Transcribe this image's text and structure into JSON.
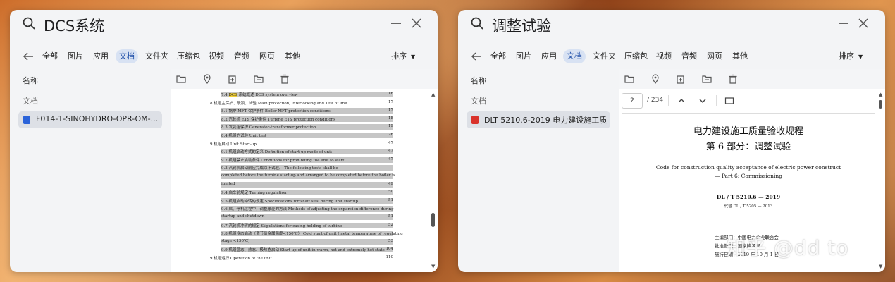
{
  "left_window": {
    "search_text": "DCS系统",
    "filters": [
      "全部",
      "图片",
      "应用",
      "文档",
      "文件夹",
      "压缩包",
      "视频",
      "音频",
      "网页",
      "其他"
    ],
    "active_filter": "文档",
    "sort_label": "排序",
    "column_header": "名称",
    "section_label": "文档",
    "file": {
      "name": "F014-1-SINOHYDRO-OPR-OM-...",
      "type_icon": "word-doc-icon",
      "icon_color": "#2b63d9"
    },
    "toc": [
      {
        "text": "7.4 DCS 系统概述  DCS system overview",
        "page": "16",
        "level": "sub"
      },
      {
        "text": "8 机组主保护、联锁、试验  Main protection, Interlocking and Test of unit",
        "page": "17",
        "level": "main"
      },
      {
        "text": "8.1 锅炉 MFT 保护条件  Boiler MFT protection conditions",
        "page": "17",
        "level": "sub"
      },
      {
        "text": "8.2 汽轮机 ETS 保护条件  Turbine ETS protection conditions",
        "page": "18",
        "level": "sub"
      },
      {
        "text": "8.3 发变组保护  Generator-transformer protection",
        "page": "19",
        "level": "sub"
      },
      {
        "text": "8.4 机组的试验  Unit test",
        "page": "26",
        "level": "sub"
      },
      {
        "text": "9 机组启动  Unit Start-up",
        "page": "47",
        "level": "main"
      },
      {
        "text": "9.1 机组启动方式的定义  Definition of start-up mode of unit",
        "page": "47",
        "level": "sub"
      },
      {
        "text": "9.2 机组禁止启动条件  Conditions for prohibiting the unit to start",
        "page": "47",
        "level": "sub"
      },
      {
        "text": "9.3 汽轮机启动前应完成以下试验。 The following tests shall be",
        "page": "",
        "level": "sub"
      },
      {
        "text": "completed before the turbine start-up and arranged to be completed before the boiler is",
        "page": "",
        "level": "sub"
      },
      {
        "text": "ignited",
        "page": "49",
        "level": "sub"
      },
      {
        "text": "9.4 启车前规定  Turning regulation",
        "page": "50",
        "level": "sub"
      },
      {
        "text": "9.5 机组启动冲转的规定  Specifications for shaft seal during unit startup",
        "page": "51",
        "level": "sub"
      },
      {
        "text": "9.6 启、停机过程中，调整胀差的方法  Methods of adjusting the expansion difference during",
        "page": "",
        "level": "sub"
      },
      {
        "text": "startup and shutdown",
        "page": "51",
        "level": "sub"
      },
      {
        "text": "9.7 汽轮机冲转的规定  Stipulations for casing holding of turbine",
        "page": "52",
        "level": "sub"
      },
      {
        "text": "9.8 机组冷态启动（调节级金属温度<150℃）  Cold start of unit (metal temperature of regulating",
        "page": "",
        "level": "sub"
      },
      {
        "text": "stage <150℃)",
        "page": "53",
        "level": "sub"
      },
      {
        "text": "9.9 机组温态、热态、极热态启动  Start-up of unit in warm, hot and extremely hot state",
        "page": "104",
        "level": "sub"
      },
      {
        "text": "9 机组运行  Operation of the unit",
        "page": "110",
        "level": "main"
      }
    ]
  },
  "right_window": {
    "search_text": "调整试验",
    "filters": [
      "全部",
      "图片",
      "应用",
      "文档",
      "文件夹",
      "压缩包",
      "视频",
      "音频",
      "网页",
      "其他"
    ],
    "active_filter": "文档",
    "sort_label": "排序",
    "column_header": "名称",
    "section_label": "文档",
    "file": {
      "name": "DLT 5210.6-2019 电力建设施工质...",
      "type_icon": "pdf-icon",
      "icon_color": "#d9322b"
    },
    "pdf": {
      "current_page": "2",
      "total_pages": "/ 234",
      "title_cn": "电力建设施工质量验收规程",
      "subtitle_cn": "第 6 部分：调整试验",
      "title_en": "Code for construction quality acceptance of electric power construct",
      "subtitle_en": "— Part 6: Commissioning",
      "code": "DL / T  5210.6 — 2019",
      "replaces": "代替 DL / T  5205 — 2013",
      "footer_lines": [
        "主编部门：中国电力企业联合会",
        "批准部门：国家能源局",
        "施行日期：2019 年 10 月 1 日"
      ]
    },
    "watermark": "知乎 @dd to"
  }
}
